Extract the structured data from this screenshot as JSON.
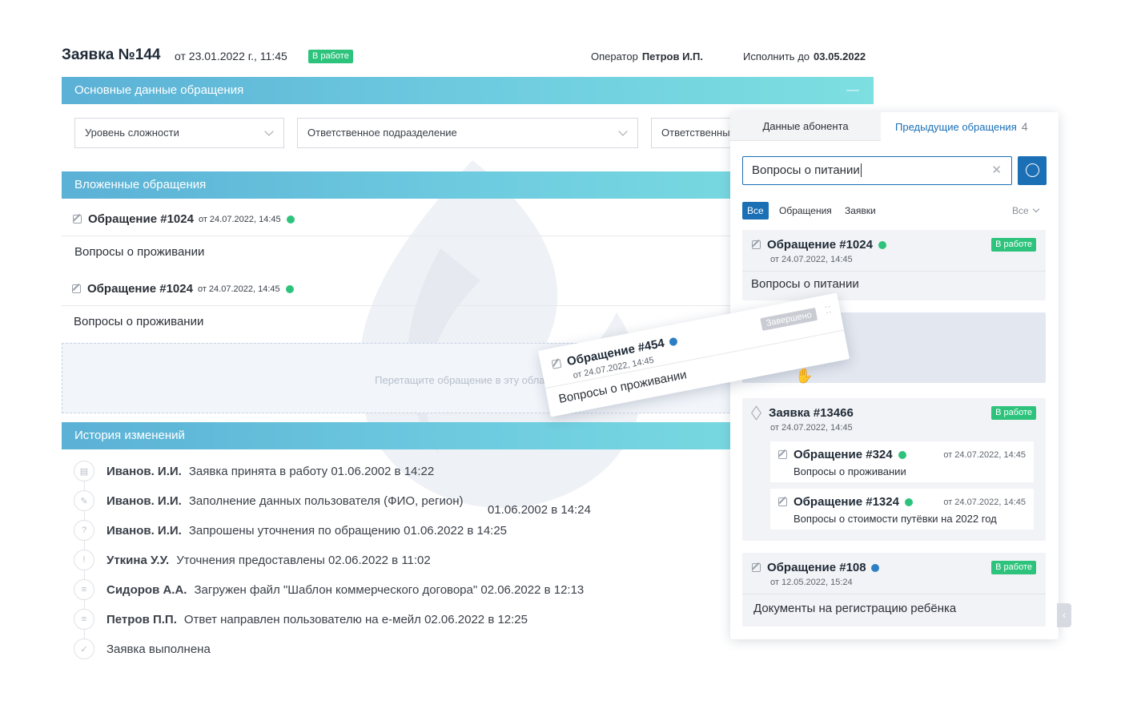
{
  "header": {
    "title": "Заявка №144",
    "date": "от 23.01.2022 г., 11:45",
    "status": "В работе",
    "operator_label": "Оператор",
    "operator_name": "Петров И.П.",
    "due_label": "Исполнить до",
    "due_date": "03.05.2022"
  },
  "main_data": {
    "title": "Основные данные обращения",
    "collapse_glyph": "—",
    "fields": [
      "Уровень сложности",
      "Ответственное подразделение",
      "Ответственны"
    ]
  },
  "nested": {
    "title": "Вложенные обращения",
    "items": [
      {
        "title": "Обращение #1024",
        "date": "от 24.07.2022, 14:45",
        "text": "Вопросы о проживании"
      },
      {
        "title": "Обращение #1024",
        "date": "от 24.07.2022, 14:45",
        "text": "Вопросы о проживании"
      }
    ],
    "dropzone": "Перетащите обращение в эту область"
  },
  "history": {
    "title": "История изменений",
    "items": [
      {
        "name": "Иванов. И.И.",
        "text": "Заявка принята в работу  01.06.2002 в 14:22"
      },
      {
        "name": "Иванов. И.И.",
        "text": "Заполнение данных пользователя (ФИО, регион)"
      },
      {
        "name": "Иванов. И.И.",
        "text": "Запрошены уточнения по обращению 01.06.2022 в 14:25"
      },
      {
        "name": "Уткина У.У.",
        "text": "Уточнения предоставлены 02.06.2022 в 11:02"
      },
      {
        "name": "Сидоров А.А.",
        "text": "Загружен файл \"Шаблон коммерческого договора\" 02.06.2022 в 12:13"
      },
      {
        "name": "Петров П.П.",
        "text": "Ответ направлен пользователю на е-мейл 02.06.2022 в 12:25"
      },
      {
        "name": "",
        "text": "Заявка выполнена"
      }
    ],
    "extra_date": "01.06.2002 в 14:24"
  },
  "panel": {
    "tabs": [
      "Данные абонента",
      "Предыдущие обращения"
    ],
    "count": "4",
    "search_value": "Вопросы о питании",
    "filters": [
      "Все",
      "Обращения",
      "Заявки"
    ],
    "filter_select": "Все",
    "cards": [
      {
        "title": "Обращение #1024",
        "date": "от 24.07.2022, 14:45",
        "status": "В работе",
        "text": "Вопросы о питании"
      },
      {
        "title": "Заявка #13466",
        "date": "от 24.07.2022, 14:45",
        "status": "В работе",
        "subs": [
          {
            "title": "Обращение #324",
            "date": "от 24.07.2022, 14:45",
            "text": "Вопросы о проживании"
          },
          {
            "title": "Обращение #1324",
            "date": "от 24.07.2022, 14:45",
            "text": "Вопросы о стоимости путёвки на 2022 год"
          }
        ]
      },
      {
        "title": "Обращение #108",
        "date": "от 12.05.2022, 15:24",
        "status": "В работе",
        "text": "Документы на регистрацию ребёнка"
      }
    ]
  },
  "drag_card": {
    "title": "Обращение #454",
    "date": "от 24.07.2022, 14:45",
    "status": "Завершено",
    "text": "Вопросы о проживании"
  },
  "icons": {
    "close_glyph": "✕",
    "collapse_glyph": "‹",
    "hand_glyph": "✋"
  },
  "colors": {
    "accent": "#1a6fb5",
    "status_green": "#2ec37c",
    "bar_start": "#5bb1d6",
    "bar_end": "#7ddfe0"
  }
}
